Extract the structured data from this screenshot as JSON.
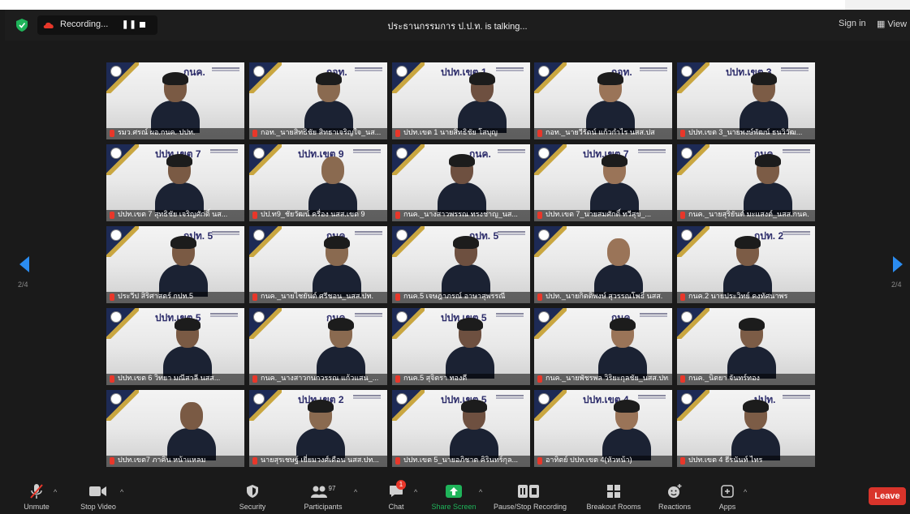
{
  "window": {
    "recording_label": "Recording...",
    "talking_text": "ประธานกรรมการ ป.ป.ท. is talking...",
    "signin_label": "Sign in",
    "view_label": "View"
  },
  "gallery": {
    "page_left": "2/4",
    "page_right": "2/4",
    "tiles": [
      {
        "name": "รมว.ศรณ์ ผอ.กนค. ปปท.",
        "org": "กนค.",
        "hair": true
      },
      {
        "name": "กอท._นายสิทธิชัย สิทธาเจริญใจ_นส...",
        "org": "กอท.",
        "hair": true
      },
      {
        "name": "ปปท.เขต 1 นายสิทธิชัย โสบุญ",
        "org": "ปปท.เขต 1",
        "hair": true
      },
      {
        "name": "กอท._นายวีรัตน์ แก้วกำไร นสส.ปส",
        "org": "กอท.",
        "hair": true
      },
      {
        "name": "ปปท.เขต 3_นายพงษ์พัฒน์ ธนวิวัฒ...",
        "org": "ปปท.เขต 3",
        "hair": true
      },
      {
        "name": "ปปท.เขต 7 สุทธิชัย เจริญศักดิ์ นส...",
        "org": "ปปท.เขต 7",
        "hair": true
      },
      {
        "name": "ปป.ท9_ชัยวัฒน์ ครื่อง นสส.เขต 9",
        "org": "ปปท.เขต 9",
        "hair": false
      },
      {
        "name": "กนค._นางสาวพรรณ ทรงชาญ_นส...",
        "org": "กนค.",
        "hair": true
      },
      {
        "name": "ปปท.เขต 7_นายสมศักดิ์ ทวีสุข_...",
        "org": "ปปท.เขต 7",
        "hair": true
      },
      {
        "name": "กนค._นายสุริยันต์ มะแสงต์_นสส.กนค.",
        "org": "กนค.",
        "hair": true
      },
      {
        "name": "ประวีป สิริศาสตร์ กปท.5",
        "org": "กปท. 5",
        "hair": true
      },
      {
        "name": "กนค._นายไชยันต์ ศรีชอน_นสส.ปท.",
        "org": "กนค.",
        "hair": true
      },
      {
        "name": "กนค.5 เจษฎาภรณ์ อาษาสุพรรณี",
        "org": "กปท. 5",
        "hair": true
      },
      {
        "name": "ปปท._นายกิตติพงษ์ สุวรรณโพธิ์ นสส.",
        "org": "",
        "hair": false
      },
      {
        "name": "กนค.2 นายประวิทย์ คงทัศนาพร",
        "org": "กปท. 2",
        "hair": true
      },
      {
        "name": "ปปท.เขต 6 วิทยา มณีสาลี นสส...",
        "org": "ปปท.เขต 5",
        "hair": true
      },
      {
        "name": "กนค._นางสาวกนกวรรณ แก้วแสน_...",
        "org": "กนค.",
        "hair": true
      },
      {
        "name": "กนค.5 สุจิตรา ทองดี",
        "org": "ปปท.เขต 5",
        "hair": true
      },
      {
        "name": "กนค._นายพัชรพล วิริยะกุลชัย_นสส.ปท.",
        "org": "กนค.",
        "hair": true
      },
      {
        "name": "กนค._นิตยา จันทร์ทอง",
        "org": "",
        "hair": true
      },
      {
        "name": "ปปท.เขต7 ภาคิน หน้าแหลม",
        "org": "",
        "hair": false
      },
      {
        "name": "นายสุรเชษฐ์ เยี่ยมวงศ์เดือน นสส.ปท...",
        "org": "ปปท.เขต 2",
        "hair": true
      },
      {
        "name": "ปปท.เขต 5_นายอภิชาต คิรินทร์กุล...",
        "org": "ปปท.เขต 5",
        "hair": true
      },
      {
        "name": "อาทิตย์ ปปท.เขต 4(หัวหน้า)",
        "org": "ปปท.เขต 4",
        "hair": true
      },
      {
        "name": "ปปท.เขต 4 ธีรนันท์ ไทร",
        "org": "ปปท.",
        "hair": true
      }
    ]
  },
  "toolbar": {
    "unmute": "Unmute",
    "stop_video": "Stop Video",
    "security": "Security",
    "participants": "Participants",
    "participants_count": "97",
    "chat": "Chat",
    "chat_badge": "1",
    "share_screen": "Share Screen",
    "pause_recording": "Pause/Stop Recording",
    "breakout_rooms": "Breakout Rooms",
    "reactions": "Reactions",
    "apps": "Apps",
    "leave": "Leave"
  },
  "colors": {
    "accent_blue": "#2b8cf0",
    "share_green": "#1fb45a",
    "leave_red": "#d9342b",
    "mute_red": "#e8372a"
  }
}
